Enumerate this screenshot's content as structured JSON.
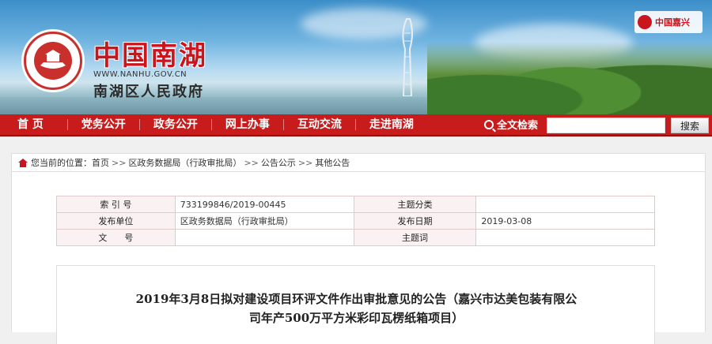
{
  "header": {
    "title": "中国南湖",
    "domain": "WWW.NANHU.GOV.CN",
    "subtitle": "南湖区人民政府",
    "corner_badge": "中国嘉兴"
  },
  "nav": {
    "items": [
      "首 页",
      "党务公开",
      "政务公开",
      "网上办事",
      "互动交流",
      "走进南湖"
    ],
    "search_label": "全文检索",
    "search_value": "",
    "search_button": "搜索"
  },
  "breadcrumb": {
    "prefix": "您当前的位置：",
    "items": [
      "首页",
      "区政务数据局（行政审批局）",
      "公告公示",
      "其他公告"
    ],
    "separator": ">>"
  },
  "meta": {
    "rows": [
      {
        "l1": "索 引 号",
        "v1": "733199846/2019-00445",
        "l2": "主题分类",
        "v2": ""
      },
      {
        "l1": "发布单位",
        "v1": "区政务数据局（行政审批局）",
        "l2": "发布日期",
        "v2": "2019-03-08"
      },
      {
        "l1": "文　　号",
        "v1": "",
        "l2": "主题词",
        "v2": ""
      }
    ]
  },
  "document": {
    "title_line1": "2019年3月8日拟对建设项目环评文件作出审批意见的公告（嘉兴市达美包装有限公",
    "title_line2": "司年产500万平方米彩印瓦楞纸箱项目）"
  },
  "colors": {
    "nav_red": "#c81c1c",
    "title_red": "#c9151e"
  }
}
